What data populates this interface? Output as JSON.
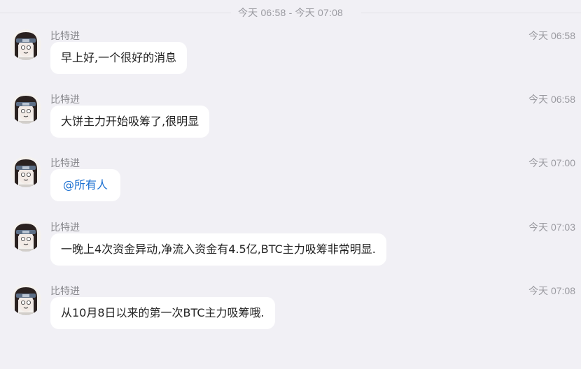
{
  "divider": {
    "text": "今天 06:58 - 今天 07:08"
  },
  "colors": {
    "background": "#f1f0f5",
    "bubble": "#ffffff",
    "mention": "#1a6fd1",
    "meta_text": "#9a9aa0"
  },
  "messages": [
    {
      "sender": "比特进",
      "time": "今天 06:58",
      "text": "早上好,一个很好的消息",
      "type": "text"
    },
    {
      "sender": "比特进",
      "time": "今天 06:58",
      "text": "大饼主力开始吸筹了,很明显",
      "type": "text"
    },
    {
      "sender": "比特进",
      "time": "今天 07:00",
      "text": "@所有人",
      "type": "mention"
    },
    {
      "sender": "比特进",
      "time": "今天 07:03",
      "text": "一晚上4次资金异动,净流入资金有4.5亿,BTC主力吸筹非常明显.",
      "type": "text"
    },
    {
      "sender": "比特进",
      "time": "今天 07:08",
      "text": "从10月8日以来的第一次BTC主力吸筹哦.",
      "type": "text"
    }
  ]
}
